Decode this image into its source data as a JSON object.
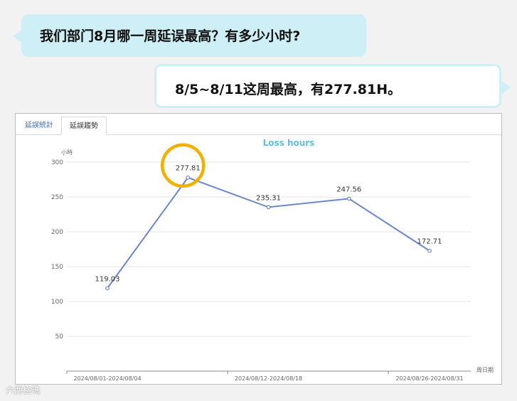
{
  "chat": {
    "question": "我们部门8月哪一周延误最高？有多少小时?",
    "answer": "8/5~8/11这周最高，有277.81H。"
  },
  "tabs": [
    "延誤統計",
    "延誤趨勢"
  ],
  "active_tab": 1,
  "chart_data": {
    "type": "line",
    "title": "Loss hours",
    "ylabel": "小時",
    "xlabel": "周日期",
    "ylim": [
      0,
      300
    ],
    "yticks": [
      50,
      100,
      150,
      200,
      250,
      300
    ],
    "x_tick_labels": [
      "2024/08/01-2024/08/04",
      "2024/08/12-2024/08/18",
      "2024/08/26-2024/08/31"
    ],
    "x_tick_label_indices": [
      0,
      2,
      4
    ],
    "series": [
      {
        "values": [
          119.03,
          277.81,
          235.31,
          247.56,
          172.71
        ]
      }
    ],
    "highlight_index": 1,
    "colors": {
      "line": "#6a87cc",
      "title": "#5cc0e0",
      "highlight": "#f2b100"
    }
  },
  "watermark": "六西格瑪"
}
